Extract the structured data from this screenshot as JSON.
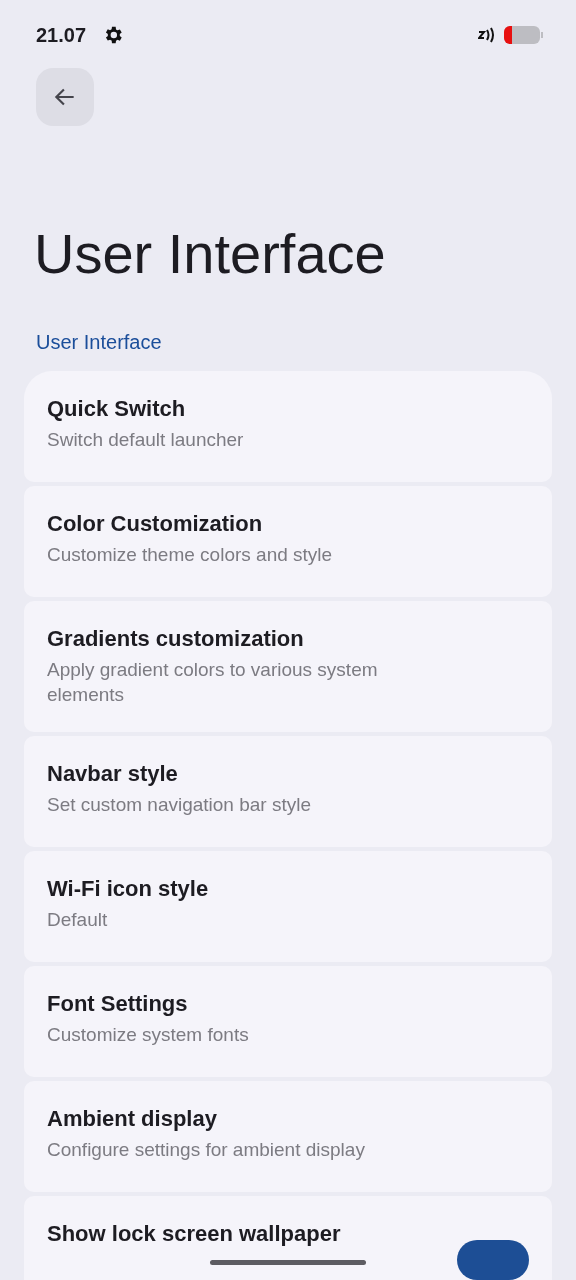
{
  "status_bar": {
    "time": "21.07"
  },
  "title": "User Interface",
  "section": "User Interface",
  "items": [
    {
      "kind": "link",
      "title": "Quick Switch",
      "summary": "Switch default launcher"
    },
    {
      "kind": "link",
      "title": "Color Customization",
      "summary": "Customize theme colors and style"
    },
    {
      "kind": "link",
      "title": "Gradients customization",
      "summary": "Apply gradient colors to various system elements"
    },
    {
      "kind": "link",
      "title": "Navbar style",
      "summary": "Set custom navigation bar style"
    },
    {
      "kind": "link",
      "title": "Wi-Fi icon style",
      "summary": "Default"
    },
    {
      "kind": "link",
      "title": "Font Settings",
      "summary": "Customize system fonts"
    },
    {
      "kind": "link",
      "title": "Ambient display",
      "summary": "Configure settings for ambient display"
    },
    {
      "kind": "toggle",
      "title": "Show lock screen wallpaper",
      "on": true
    }
  ]
}
